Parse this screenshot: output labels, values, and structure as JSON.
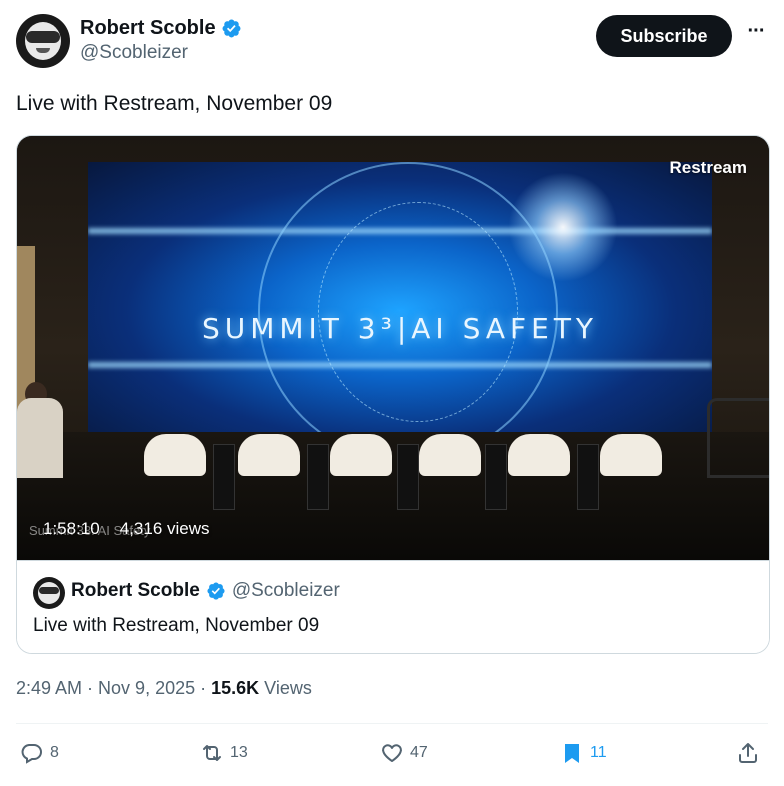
{
  "author": {
    "display_name": "Robert Scoble",
    "handle": "@Scobleizer",
    "verified": true,
    "verified_color": "#1d9bf0"
  },
  "header": {
    "subscribe_label": "Subscribe",
    "more_icon": "more-horizontal-icon"
  },
  "tweet": {
    "text": "Live with Restream, November 09"
  },
  "video": {
    "brand": "Restream",
    "screen_title": "SUMMIT 3³|AI SAFETY",
    "overlay_caption": "Summit 33: AI Safety",
    "duration": "1:58:10",
    "views": "4,316 views"
  },
  "quoted": {
    "display_name": "Robert Scoble",
    "handle": "@Scobleizer",
    "text": "Live with Restream, November 09"
  },
  "meta": {
    "time": "2:49 AM",
    "date": "Nov 9, 2025",
    "separator": "·",
    "views_count": "15.6K",
    "views_label": "Views"
  },
  "actions": {
    "replies": "8",
    "reposts": "13",
    "likes": "47",
    "bookmarks": "11",
    "bookmark_color": "#1d9bf0"
  }
}
